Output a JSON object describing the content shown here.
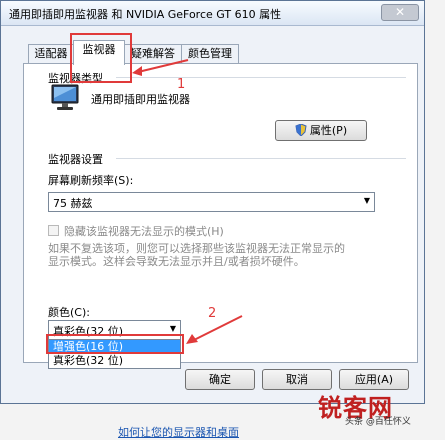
{
  "window": {
    "title": "通用即插即用监视器 和 NVIDIA GeForce GT 610 属性",
    "close_glyph": "✕"
  },
  "tabs": [
    "适配器",
    "监视器",
    "疑难解答",
    "颜色管理"
  ],
  "monitor_type": {
    "section_label": "监视器类型",
    "name": "通用即插即用监视器",
    "properties_button": "属性(P)"
  },
  "settings": {
    "section_label": "监视器设置",
    "refresh_label": "屏幕刷新频率(S):",
    "refresh_value": "75 赫兹",
    "hide_modes_label": "隐藏该监视器无法显示的模式(H)",
    "hide_modes_checked": false,
    "hint_line1": "如果不复选该项，则您可以选择那些该监视器无法正常显示的",
    "hint_line2": "显示模式。这样会导致无法显示并且/或者损坏硬件。"
  },
  "colors": {
    "label": "颜色(C):",
    "selected": "真彩色(32 位)",
    "options": [
      "增强色(16 位)",
      "真彩色(32 位)"
    ],
    "highlighted_index": 0
  },
  "buttons": {
    "ok": "确定",
    "cancel": "取消",
    "apply": "应用(A)"
  },
  "annotations": {
    "step1": "1",
    "step2": "2",
    "accent": "#e03a3a"
  },
  "bottom_link": "如何让您的显示器和桌面",
  "watermark": {
    "brand": "锐客网",
    "sub": "头条 @百任怀义"
  }
}
